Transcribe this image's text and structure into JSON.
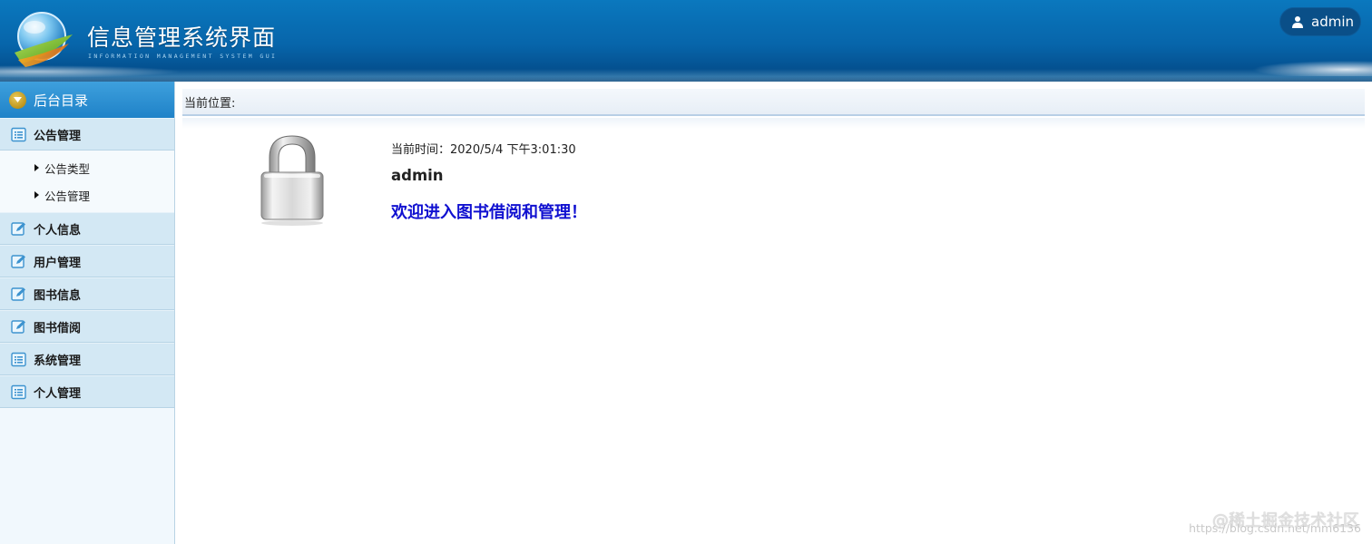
{
  "header": {
    "title": "信息管理系统界面",
    "subtitle": "INFORMATION MANAGEMENT SYSTEM GUI",
    "user": "admin",
    "user_icon": "user-icon"
  },
  "sidebar": {
    "heading": "后台目录",
    "groups": [
      {
        "label": "公告管理",
        "icon": "list-icon",
        "children": [
          {
            "label": "公告类型"
          },
          {
            "label": "公告管理"
          }
        ]
      },
      {
        "label": "个人信息",
        "icon": "edit-icon"
      },
      {
        "label": "用户管理",
        "icon": "edit-icon"
      },
      {
        "label": "图书信息",
        "icon": "edit-icon"
      },
      {
        "label": "图书借阅",
        "icon": "edit-icon"
      },
      {
        "label": "系统管理",
        "icon": "list-icon"
      },
      {
        "label": "个人管理",
        "icon": "list-icon"
      }
    ]
  },
  "main": {
    "breadcrumb": "当前位置:",
    "time_text": "当前时间：2020/5/4 下午3:01:30",
    "username": "admin",
    "welcome": "欢迎进入图书借阅和管理！",
    "lock_icon": "padlock-icon"
  },
  "watermark": {
    "url": "https://blog.csdn.net/mm6136",
    "site": "@稀土掘金技术社区"
  },
  "colors": {
    "header_blue": "#0765aa",
    "sidebar_bg": "#f1f8fd",
    "item_bg": "#d3e8f4",
    "welcome_blue": "#1010d0"
  }
}
